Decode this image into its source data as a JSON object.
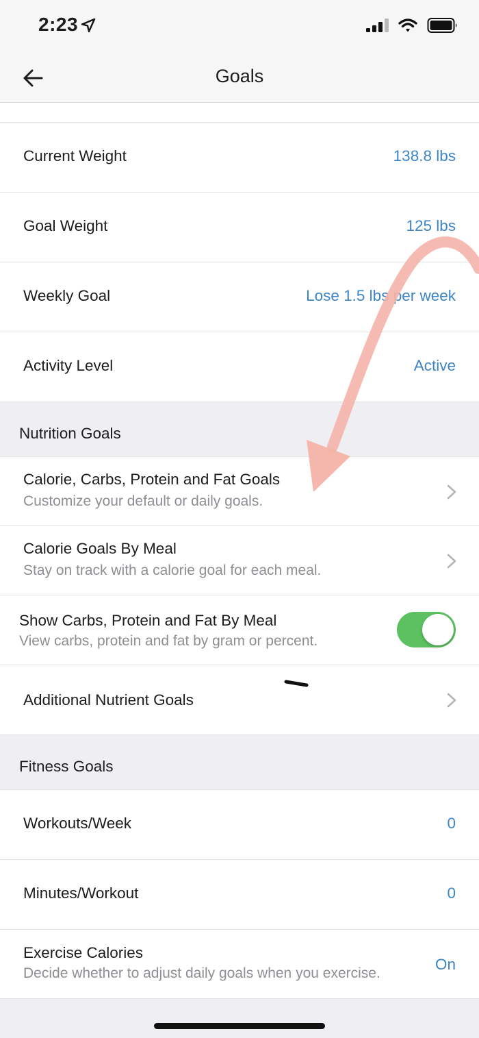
{
  "status_bar": {
    "time": "2:23"
  },
  "nav": {
    "title": "Goals"
  },
  "weight_goals": [
    {
      "label": "Current Weight",
      "value": "138.8 lbs"
    },
    {
      "label": "Goal Weight",
      "value": "125 lbs"
    },
    {
      "label": "Weekly Goal",
      "value": "Lose 1.5 lbs per week"
    },
    {
      "label": "Activity Level",
      "value": "Active"
    }
  ],
  "nutrition": {
    "header": "Nutrition Goals",
    "items": [
      {
        "label": "Calorie, Carbs, Protein and Fat Goals",
        "subtitle": "Customize your default or daily goals."
      },
      {
        "label": "Calorie Goals By Meal",
        "subtitle": "Stay on track with a calorie goal for each meal."
      }
    ],
    "toggle_item": {
      "label": "Show Carbs, Protein and Fat By Meal",
      "subtitle": "View carbs, protein and fat by gram or percent.",
      "enabled": true
    },
    "additional": {
      "label": "Additional Nutrient Goals"
    }
  },
  "fitness": {
    "header": "Fitness Goals",
    "items": [
      {
        "label": "Workouts/Week",
        "value": "0"
      },
      {
        "label": "Minutes/Workout",
        "value": "0"
      }
    ],
    "exercise": {
      "label": "Exercise Calories",
      "subtitle": "Decide whether to adjust daily goals when you exercise.",
      "value": "On"
    }
  },
  "colors": {
    "accent": "#3d85c6",
    "toggle_on": "#5dc161",
    "annotation_arrow": "#f4b2a8"
  },
  "icons": {
    "back": "arrow-left-icon",
    "chevron": "chevron-right-icon",
    "location": "location-arrow-icon"
  }
}
